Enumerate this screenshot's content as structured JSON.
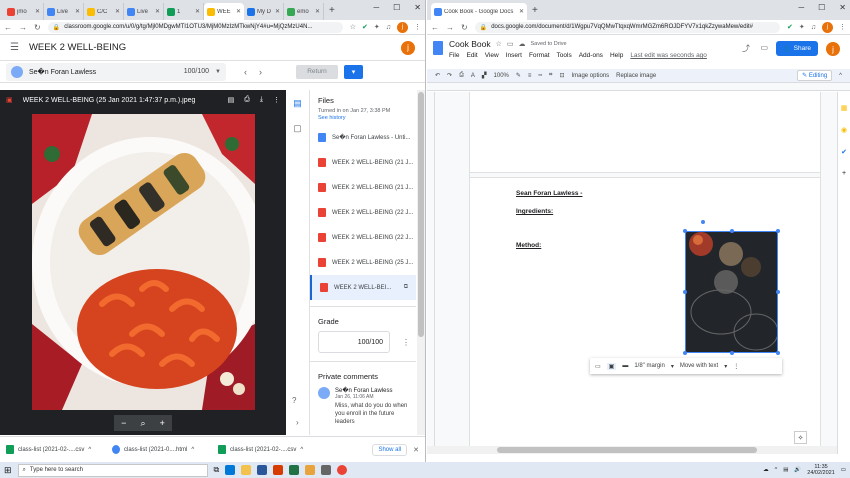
{
  "left_window": {
    "tabs": [
      {
        "label": "jmo",
        "color": "#ea4335"
      },
      {
        "label": "Live",
        "color": "#4285f4"
      },
      {
        "label": "C/C",
        "color": "#fbbc04"
      },
      {
        "label": "Live",
        "color": "#4285f4"
      },
      {
        "label": "1",
        "color": "#0f9d58"
      },
      {
        "label": "WEE",
        "color": "#fbbc04",
        "active": true
      },
      {
        "label": "My D",
        "color": "#1a73e8"
      },
      {
        "label": "emo",
        "color": "#34a853"
      }
    ],
    "url": "classroom.google.com/u/0/g/tg/Mjl0MDgwMTI1OTU3/MjM0MzIzMTkwNjY4#u=MjQzMzU4N...",
    "header_title": "WEEK 2 WELL-BEING",
    "student_name": "Se�n Foran Lawless",
    "grade_display": "100/100",
    "return_label": "Return",
    "viewer_title": "WEEK 2 WELL-BEING (25 Jan 2021 1:47:37 p.m.).jpeg",
    "files_heading": "Files",
    "turned_in": "Turned in on Jan 27, 3:38 PM",
    "see_history": "See history",
    "files": [
      {
        "label": "Se�n Foran Lawless - Unti...",
        "type": "doc"
      },
      {
        "label": "WEEK 2 WELL-BEING (21 J...",
        "type": "img"
      },
      {
        "label": "WEEK 2 WELL-BEING (21 J...",
        "type": "img"
      },
      {
        "label": "WEEK 2 WELL-BEING (22 J...",
        "type": "img"
      },
      {
        "label": "WEEK 2 WELL-BEING (22 J...",
        "type": "img"
      },
      {
        "label": "WEEK 2 WELL-BEING (25 J...",
        "type": "img"
      },
      {
        "label": "WEEK 2 WELL-BEI...",
        "type": "img",
        "selected": true
      }
    ],
    "grade_heading": "Grade",
    "grade_value": "100/100",
    "comments_heading": "Private comments",
    "comment": {
      "author": "Se�n Foran Lawless",
      "date": "Jan 26, 11:06 AM",
      "text": "Miss, what do you do when you enroll in the future leaders"
    },
    "downloads": [
      "class-list (2021-02-....csv",
      "class-list (2021-0....html",
      "class-list (2021-02-....csv"
    ],
    "show_all": "Show all"
  },
  "right_window": {
    "tab_label": "Cook Book - Google Docs",
    "url": "docs.google.com/document/d/1Wgpu7VqQMwTtqxqWmrMGZm6ROJDFYV7x1qkZzywaMew/edit#",
    "doc_title": "Cook Book",
    "saved_status": "Saved to Drive",
    "menu": [
      "File",
      "Edit",
      "View",
      "Insert",
      "Format",
      "Tools",
      "Add-ons",
      "Help"
    ],
    "last_edit": "Last edit was seconds ago",
    "share_label": "Share",
    "toolbar": {
      "zoom": "100%",
      "image_options": "Image options",
      "replace_image": "Replace image",
      "mode": "Editing"
    },
    "doc_lines": {
      "name": "Sean Foran Lawless -",
      "ingredients": "Ingredients:",
      "method": "Method:"
    },
    "image_toolbar": {
      "margin": "1/8\" margin",
      "move": "Move with text"
    }
  },
  "taskbar": {
    "search_placeholder": "Type here to search",
    "time": "11:35",
    "date": "24/02/2021"
  }
}
